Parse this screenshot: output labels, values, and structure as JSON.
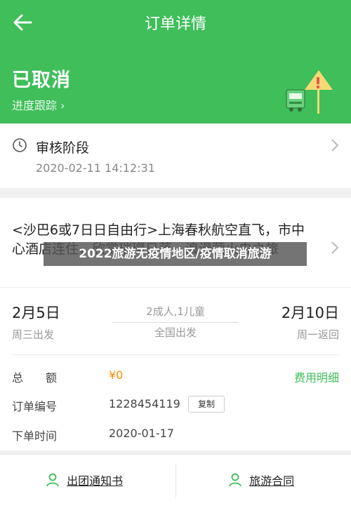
{
  "nav": {
    "title": "订单详情",
    "back_icon": "back-arrow-icon"
  },
  "status": {
    "title": "已取消",
    "progress_link": "进度跟踪 ›"
  },
  "review": {
    "title": "审核阶段",
    "time": "2020-02-11 14:12:31"
  },
  "trip": {
    "name": "<沙巴6或7日日自由行>上海春秋航空直飞，市中心酒店连住，欣赏璀璨日落，浪漫萤火虫之旅",
    "banner": "2022旅游无疫情地区/疫情取消旅游",
    "start_date": "2月5日",
    "start_day": "周三出发",
    "end_date": "2月10日",
    "end_day": "周一返回",
    "people": "2成人,1儿童",
    "departure": "全国出发"
  },
  "details": {
    "total_label": "总　　额",
    "total_value": "¥0",
    "fee_link": "费用明细",
    "order_no_label": "订单编号",
    "order_no": "1228454119",
    "copy_label": "复制",
    "order_time_label": "下单时间",
    "order_time": "2020-01-17"
  },
  "bottom_bar": {
    "notice": "出团通知书",
    "contract": "旅游合同"
  },
  "colors": {
    "brand_green": "#3fbe5a",
    "amount_orange": "#ff8a00"
  }
}
